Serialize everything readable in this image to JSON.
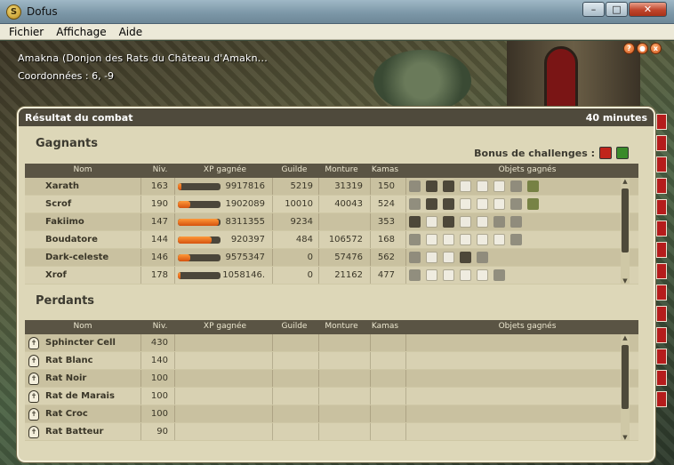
{
  "window": {
    "title": "Dofus",
    "icon": "dofus-logo-icon",
    "buttons": [
      "minimize",
      "maximize",
      "close"
    ]
  },
  "menu": [
    "Fichier",
    "Affichage",
    "Aide"
  ],
  "game": {
    "map_name": "Amakna (Donjon des Rats du Château d'Amakn...",
    "coordinates": "Coordonnées : 6, -9"
  },
  "combat": {
    "title": "Résultat du combat",
    "duration": "40 minutes",
    "bonus_label": "Bonus de challenges :",
    "bonus_colors": [
      "#c0241b",
      "#3a8a2a"
    ],
    "winners_title": "Gagnants",
    "losers_title": "Perdants",
    "columns": [
      "Nom",
      "Niv.",
      "XP gagnée",
      "Guilde",
      "Monture",
      "Kamas",
      "Objets gagnés"
    ],
    "winners": [
      {
        "name": "Xarath",
        "level": "163",
        "xp": "9917816",
        "xp_progress": 0.08,
        "guild": "5219",
        "monture": "31319",
        "kamas": "150"
      },
      {
        "name": "Scrof",
        "level": "190",
        "xp": "1902089",
        "xp_progress": 0.3,
        "guild": "10010",
        "monture": "40043",
        "kamas": "524"
      },
      {
        "name": "Fakiimo",
        "level": "147",
        "xp": "8311355",
        "xp_progress": 0.95,
        "guild": "9234",
        "monture": "",
        "kamas": "353"
      },
      {
        "name": "Boudatore",
        "level": "144",
        "xp": "920397",
        "xp_progress": 0.8,
        "guild": "484",
        "monture": "106572",
        "kamas": "168"
      },
      {
        "name": "Dark-celeste",
        "level": "146",
        "xp": "9575347",
        "xp_progress": 0.3,
        "guild": "0",
        "monture": "57476",
        "kamas": "562"
      },
      {
        "name": "Xrof",
        "level": "178",
        "xp": "1058146.",
        "xp_progress": 0.06,
        "guild": "0",
        "monture": "21162",
        "kamas": "477"
      }
    ],
    "losers": [
      {
        "name": "Sphincter Cell",
        "level": "430"
      },
      {
        "name": "Rat Blanc",
        "level": "140"
      },
      {
        "name": "Rat Noir",
        "level": "100"
      },
      {
        "name": "Rat de Marais",
        "level": "100"
      },
      {
        "name": "Rat Croc",
        "level": "100"
      },
      {
        "name": "Rat Batteur",
        "level": "90"
      }
    ]
  }
}
